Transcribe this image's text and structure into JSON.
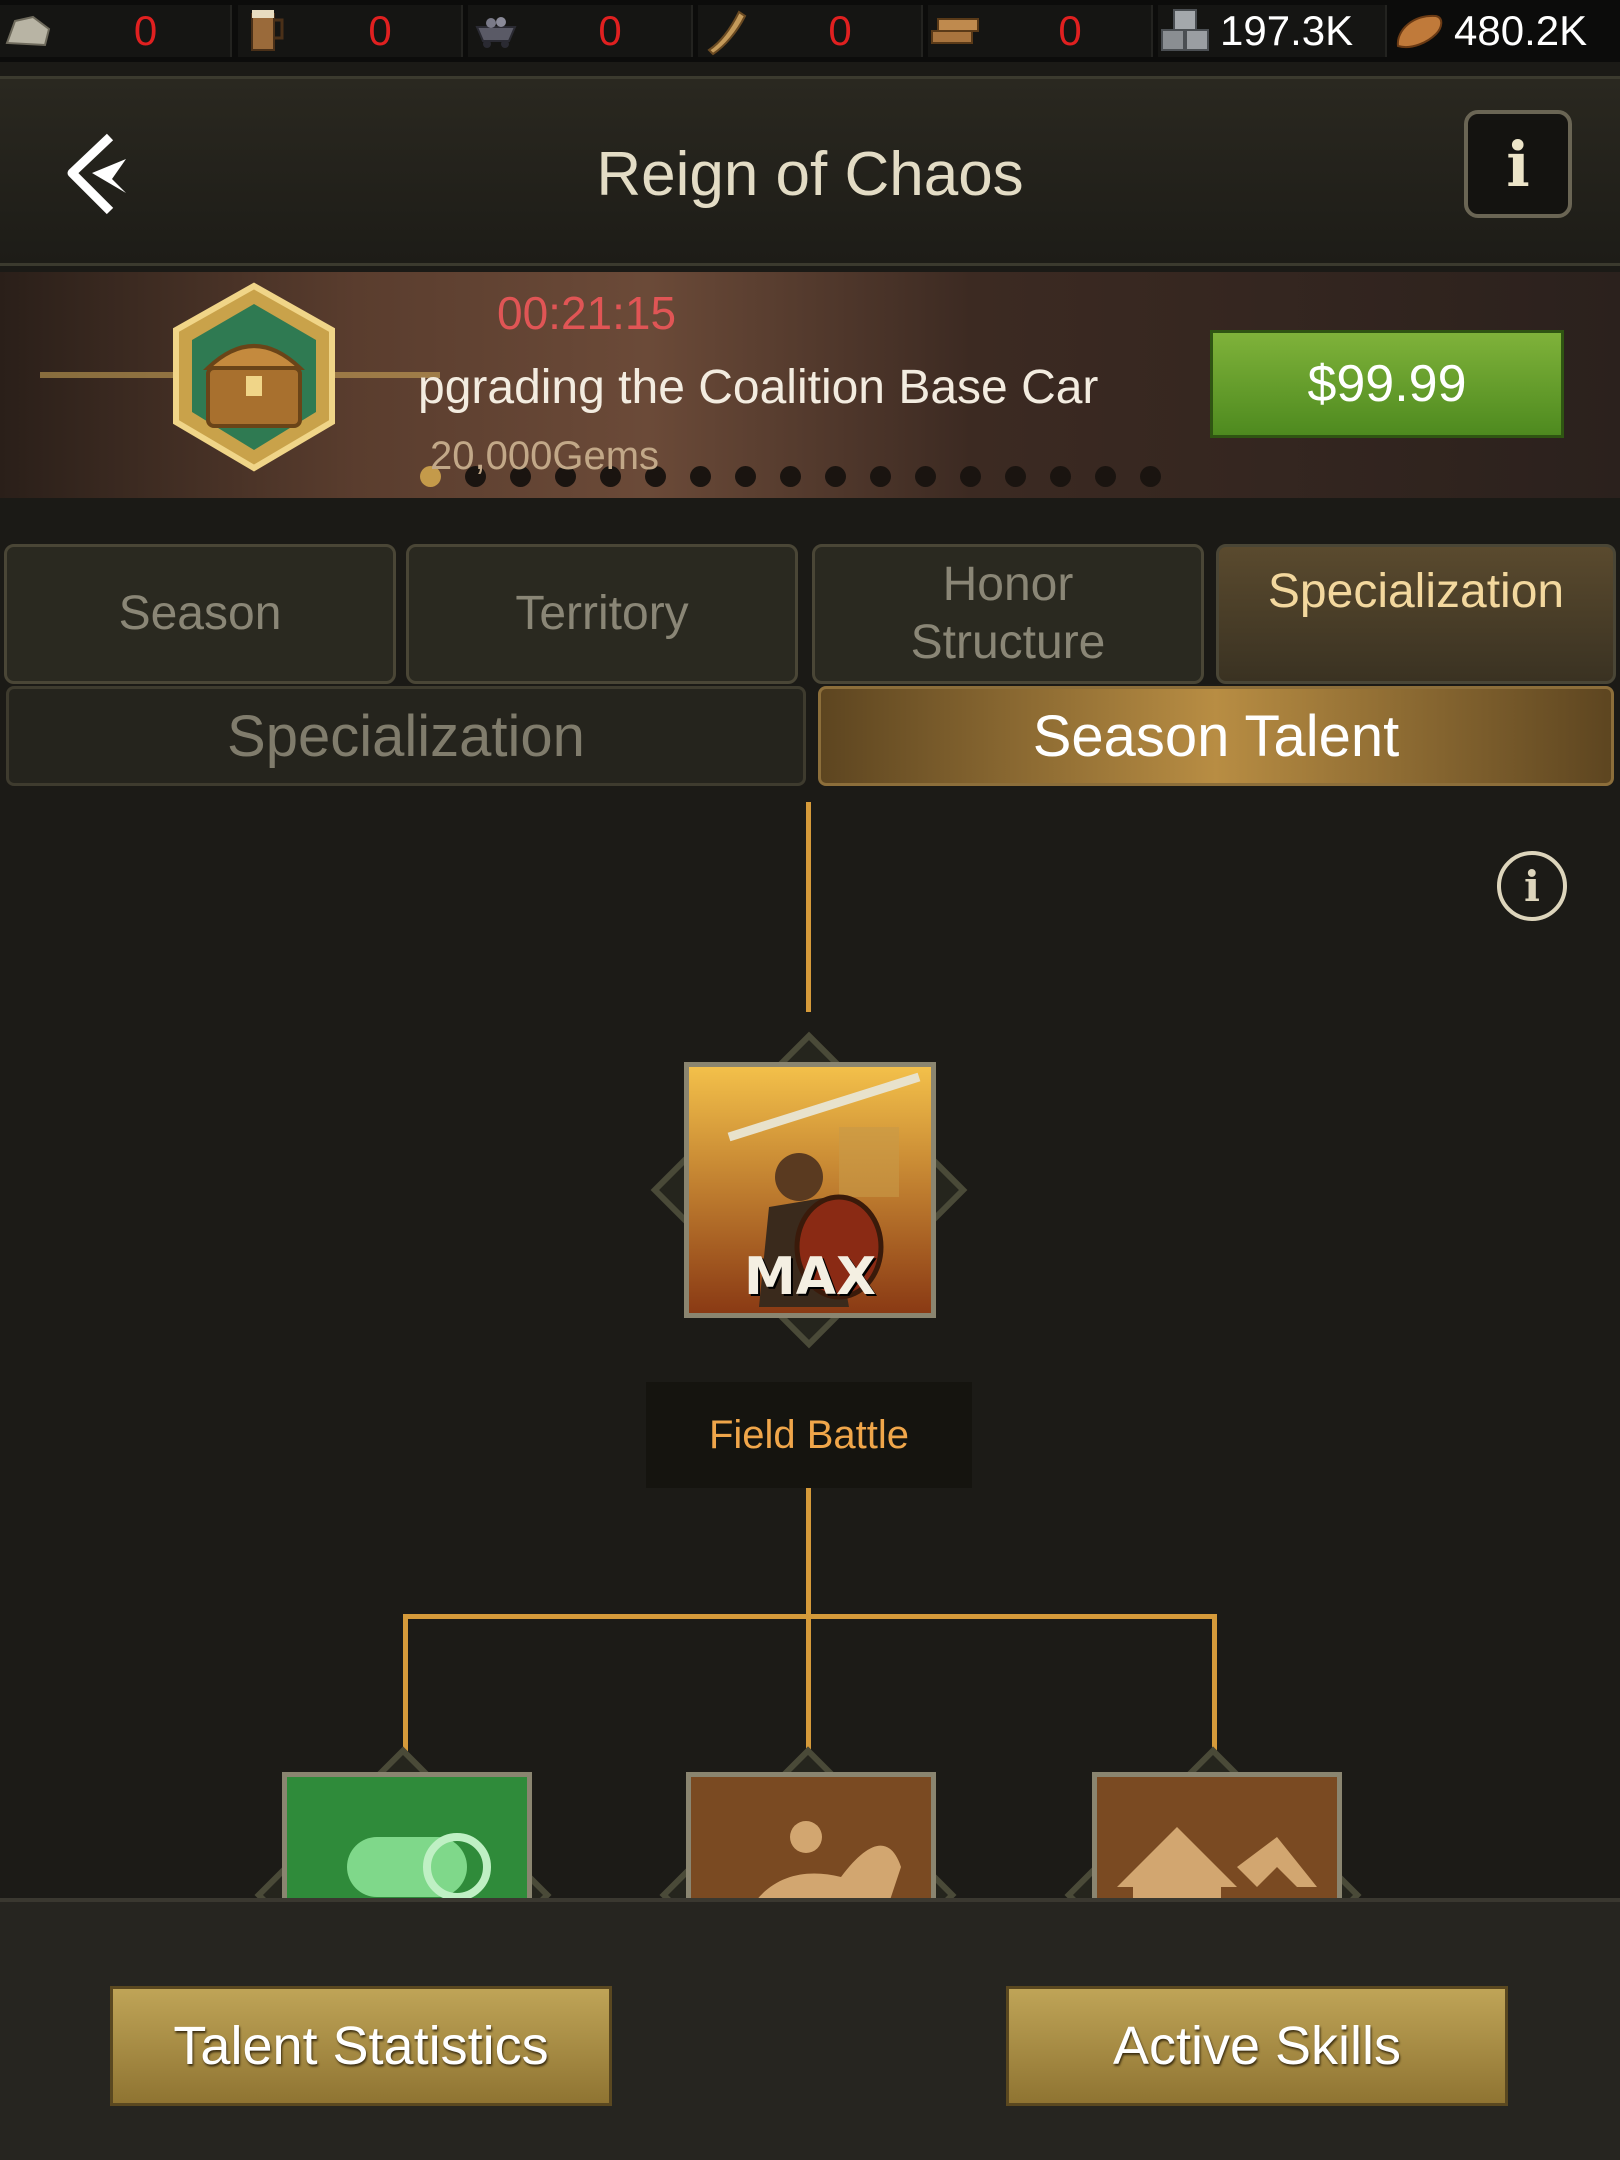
{
  "resources": [
    {
      "icon": "stone-ore-icon",
      "value": "0"
    },
    {
      "icon": "ale-mug-icon",
      "value": "0"
    },
    {
      "icon": "ore-cart-icon",
      "value": "0"
    },
    {
      "icon": "horn-icon",
      "value": "0"
    },
    {
      "icon": "lumber-icon",
      "value": "0"
    },
    {
      "icon": "stone-blocks-icon",
      "value": "197.3K"
    },
    {
      "icon": "bread-icon",
      "value": "480.2K"
    }
  ],
  "header": {
    "title": "Reign of Chaos"
  },
  "promo": {
    "timer": "00:21:15",
    "message": "pgrading the Coalition Base Car",
    "gems": "20,000Gems",
    "price": "$99.99",
    "page_count": 17,
    "active_page": 0
  },
  "category_tabs": [
    {
      "label": "Season",
      "active": false
    },
    {
      "label": "Territory",
      "active": false
    },
    {
      "label": "Honor\nStructure",
      "active": false
    },
    {
      "label": "Specialization",
      "active": true
    }
  ],
  "sub_tabs": {
    "specialization": "Specialization",
    "season_talent": "Season Talent",
    "active": "season_talent"
  },
  "talent_tree": {
    "root": {
      "name": "Field Battle",
      "level_badge": "MAX",
      "icon": "swordsman-icon"
    },
    "children": [
      {
        "icon": "scroll-icon",
        "color": "#2f8b3a"
      },
      {
        "icon": "cavalry-icon",
        "color": "#7a4a22"
      },
      {
        "icon": "buildings-icon",
        "color": "#7a4a22"
      }
    ]
  },
  "buttons": {
    "talent_statistics": "Talent Statistics",
    "active_skills": "Active Skills"
  },
  "colors": {
    "accent_gold": "#d59a3a",
    "price_green": "#6aa02f",
    "timer_red": "#e05555",
    "resource_zero": "#e02020"
  }
}
